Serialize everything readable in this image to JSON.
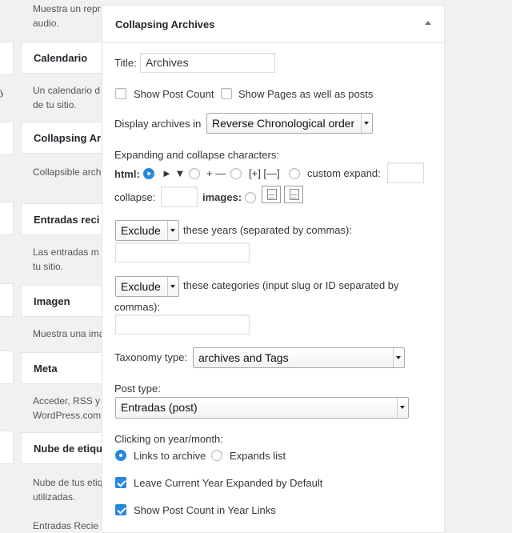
{
  "background": {
    "widgets": [
      {
        "title": "Calendario",
        "desc": [
          "Un calendario d",
          "de tu sitio."
        ]
      },
      {
        "title": "Collapsing Ar",
        "desc": [
          "Collapsible arch"
        ]
      },
      {
        "title": "Entradas reci",
        "desc": [
          "Las entradas m",
          "tu sitio."
        ]
      },
      {
        "title": "Imagen",
        "desc": [
          "Muestra una ima"
        ]
      },
      {
        "title": "Meta",
        "desc": [
          "Acceder, RSS y",
          "WordPress.com"
        ]
      },
      {
        "title": "Nube de etiqu",
        "desc": [
          "Nube de tus etiq",
          "utilizadas."
        ]
      }
    ],
    "top_desc": [
      "Muestra un repr",
      "audio."
    ],
    "bottom_desc": "Entradas Recie"
  },
  "panel": {
    "title": "Collapsing Archives",
    "title_label": "Title:",
    "title_value": "Archives",
    "show_post_count": "Show Post Count",
    "show_pages": "Show Pages as well as posts",
    "display_label": "Display archives in",
    "display_value": "Reverse Chronological order",
    "expanding_label": "Expanding and collapse characters:",
    "html_label": "html:",
    "opt1": "► ▼",
    "opt2": "+ —",
    "opt3": "[+] [—]",
    "opt4": "custom expand:",
    "collapse_label": "collapse:",
    "images_label": "images:",
    "exclude_years_value": "Exclude",
    "years_label": "these years (separated by commas):",
    "exclude_cats_value": "Exclude",
    "cats_label_1": "these categories (input slug or ID separated by",
    "cats_label_2": "commas):",
    "taxonomy_label": "Taxonomy type:",
    "taxonomy_value": "archives and Tags",
    "post_type_label": "Post type:",
    "post_type_value": "Entradas (post)",
    "clicking_label": "Clicking on year/month:",
    "links_to_archive": "Links to archive",
    "expands_list": "Expands list",
    "leave_expanded": "Leave Current Year Expanded by Default",
    "show_count_year": "Show Post Count in Year Links"
  },
  "colors": {
    "accent": "#2a8ae2"
  }
}
